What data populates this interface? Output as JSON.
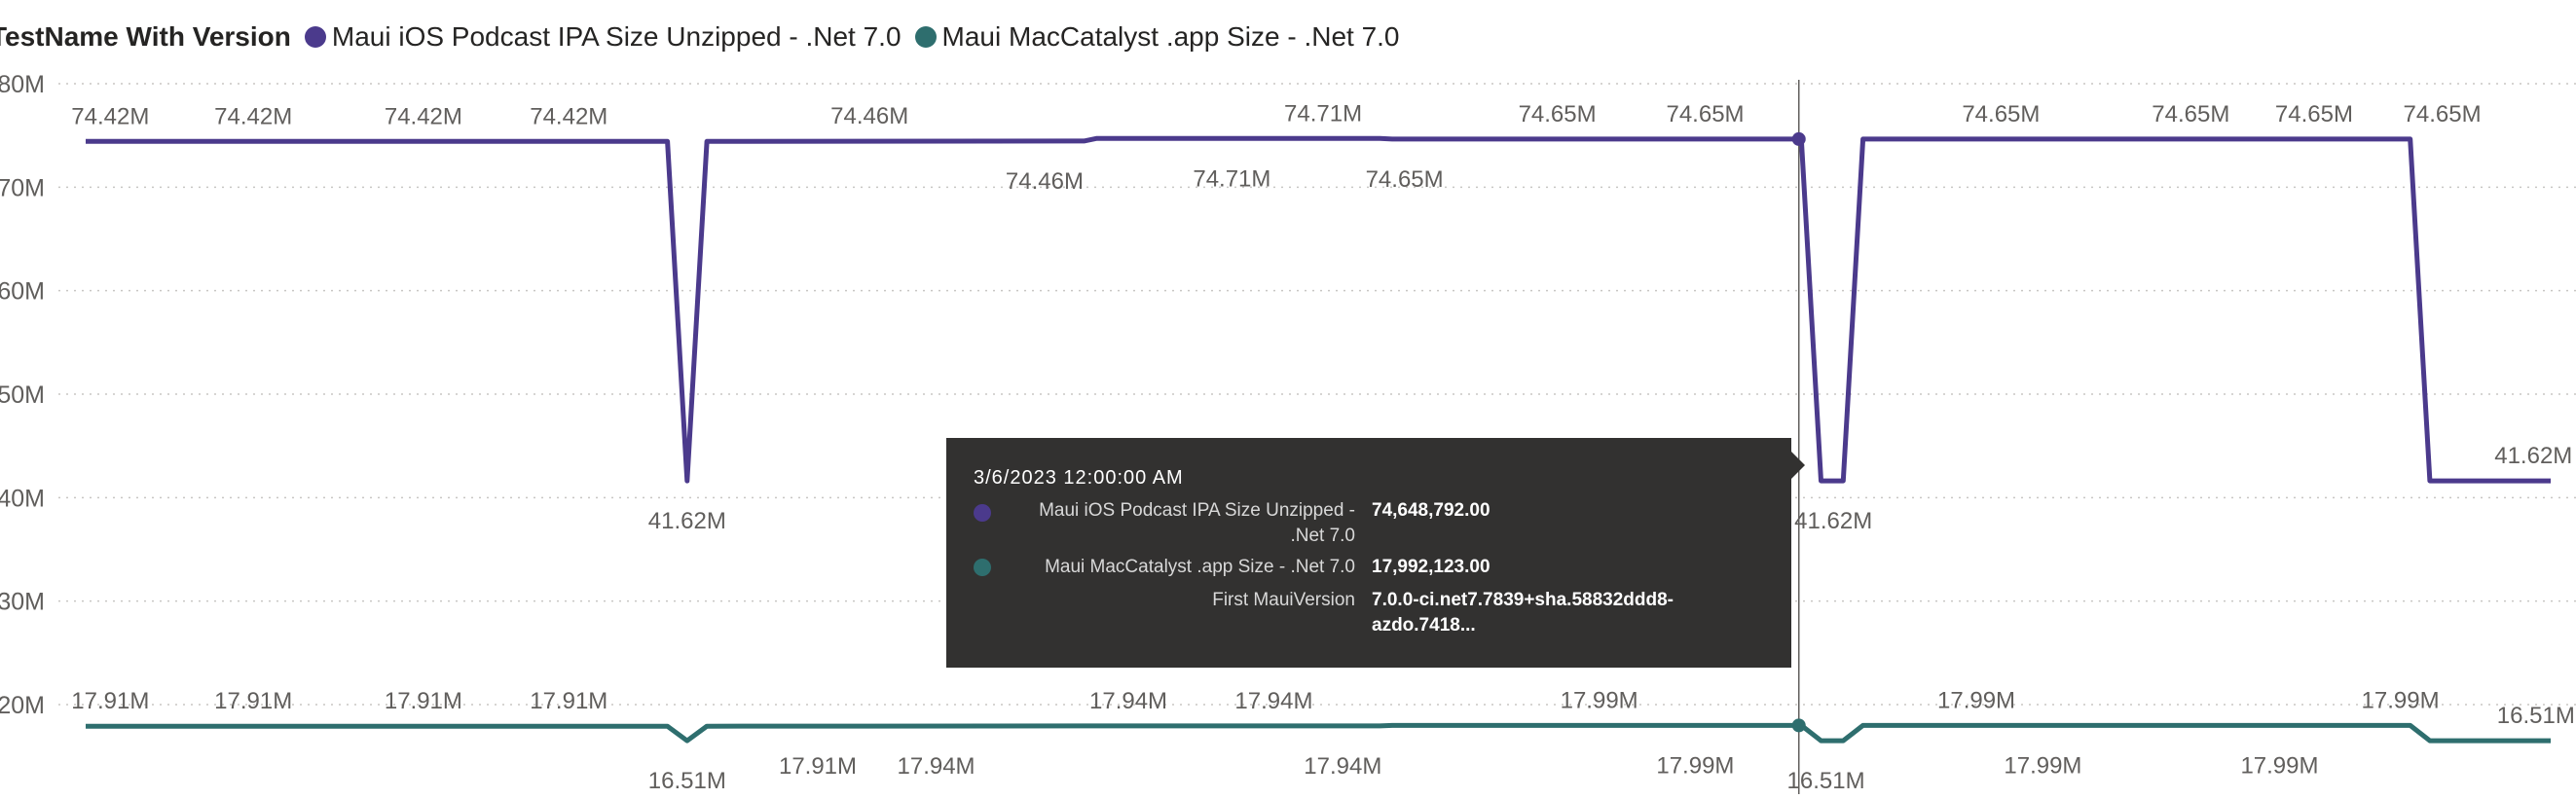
{
  "legend": {
    "title": "TestName With Version",
    "items": [
      {
        "label": "Maui iOS Podcast IPA Size Unzipped - .Net 7.0",
        "color": "#4B3A8C"
      },
      {
        "label": "Maui MacCatalyst .app Size - .Net 7.0",
        "color": "#2E6E6E"
      }
    ]
  },
  "tooltip": {
    "date": "3/6/2023 12:00:00 AM",
    "rows": [
      {
        "label": "Maui iOS Podcast IPA Size Unzipped - .Net 7.0",
        "value": "74,648,792.00",
        "color": "#4B3A8C"
      },
      {
        "label": "Maui MacCatalyst .app Size - .Net 7.0",
        "value": "17,992,123.00",
        "color": "#2E6E6E"
      },
      {
        "label": "First MauiVersion",
        "value": "7.0.0-ci.net7.7839+sha.58832ddd8-azdo.7418..."
      }
    ]
  },
  "chart_data": {
    "type": "line",
    "grid": true,
    "legend_position": "top-left",
    "ylim": [
      20,
      80
    ],
    "y_ticks": [
      "30M",
      "40M",
      "50M",
      "60M",
      "70M",
      "80M"
    ],
    "xlabel": "",
    "ylabel": "",
    "crosshair_date": "3/6/2023 12:00:00 AM",
    "series": [
      {
        "name": "Maui iOS Podcast IPA Size Unzipped - .Net 7.0",
        "color": "#4B3A8C",
        "points": [
          {
            "x": 0,
            "y": 74.42
          },
          {
            "x": 0.236,
            "y": 74.42
          },
          {
            "x": 0.244,
            "y": 41.62
          },
          {
            "x": 0.252,
            "y": 74.42
          },
          {
            "x": 0.405,
            "y": 74.46
          },
          {
            "x": 0.41,
            "y": 74.71
          },
          {
            "x": 0.525,
            "y": 74.71
          },
          {
            "x": 0.53,
            "y": 74.65
          },
          {
            "x": 0.696,
            "y": 74.65
          },
          {
            "x": 0.704,
            "y": 41.62
          },
          {
            "x": 0.713,
            "y": 41.62
          },
          {
            "x": 0.721,
            "y": 74.65
          },
          {
            "x": 0.943,
            "y": 74.65
          },
          {
            "x": 0.951,
            "y": 41.62
          },
          {
            "x": 1,
            "y": 41.62
          }
        ],
        "data_labels": [
          {
            "text": "74.42M",
            "x": 0.01,
            "pos": "above",
            "y": 74.42
          },
          {
            "text": "74.42M",
            "x": 0.068,
            "pos": "above",
            "y": 74.42
          },
          {
            "text": "74.42M",
            "x": 0.137,
            "pos": "above",
            "y": 74.42
          },
          {
            "text": "74.42M",
            "x": 0.196,
            "pos": "above",
            "y": 74.42
          },
          {
            "text": "41.62M",
            "x": 0.244,
            "pos": "below",
            "y": 41.62
          },
          {
            "text": "74.46M",
            "x": 0.318,
            "pos": "above",
            "y": 74.46
          },
          {
            "text": "74.46M",
            "x": 0.389,
            "pos": "below",
            "y": 74.46
          },
          {
            "text": "74.71M",
            "x": 0.465,
            "pos": "below",
            "y": 74.71
          },
          {
            "text": "74.71M",
            "x": 0.502,
            "pos": "above",
            "y": 74.71
          },
          {
            "text": "74.65M",
            "x": 0.535,
            "pos": "below",
            "y": 74.65
          },
          {
            "text": "74.65M",
            "x": 0.597,
            "pos": "above",
            "y": 74.65
          },
          {
            "text": "74.65M",
            "x": 0.657,
            "pos": "above",
            "y": 74.65
          },
          {
            "text": "41.62M",
            "x": 0.709,
            "pos": "below",
            "y": 41.62
          },
          {
            "text": "74.65M",
            "x": 0.777,
            "pos": "above",
            "y": 74.65
          },
          {
            "text": "74.65M",
            "x": 0.854,
            "pos": "above",
            "y": 74.65
          },
          {
            "text": "74.65M",
            "x": 0.904,
            "pos": "above",
            "y": 74.65
          },
          {
            "text": "74.65M",
            "x": 0.956,
            "pos": "above",
            "y": 74.65
          },
          {
            "text": "41.62M",
            "x": 0.993,
            "pos": "above",
            "y": 41.62
          }
        ]
      },
      {
        "name": "Maui MacCatalyst .app Size - .Net 7.0",
        "color": "#2E6E6E",
        "points": [
          {
            "x": 0,
            "y": 17.91
          },
          {
            "x": 0.236,
            "y": 17.91
          },
          {
            "x": 0.244,
            "y": 16.51
          },
          {
            "x": 0.252,
            "y": 17.91
          },
          {
            "x": 0.405,
            "y": 17.94
          },
          {
            "x": 0.525,
            "y": 17.94
          },
          {
            "x": 0.53,
            "y": 17.99
          },
          {
            "x": 0.696,
            "y": 17.99
          },
          {
            "x": 0.704,
            "y": 16.51
          },
          {
            "x": 0.713,
            "y": 16.51
          },
          {
            "x": 0.721,
            "y": 17.99
          },
          {
            "x": 0.943,
            "y": 17.99
          },
          {
            "x": 0.951,
            "y": 16.51
          },
          {
            "x": 1,
            "y": 16.51
          }
        ],
        "data_labels": [
          {
            "text": "17.91M",
            "x": 0.01,
            "pos": "above",
            "y": 17.91
          },
          {
            "text": "17.91M",
            "x": 0.068,
            "pos": "above",
            "y": 17.91
          },
          {
            "text": "17.91M",
            "x": 0.137,
            "pos": "above",
            "y": 17.91
          },
          {
            "text": "17.91M",
            "x": 0.196,
            "pos": "above",
            "y": 17.91
          },
          {
            "text": "16.51M",
            "x": 0.244,
            "pos": "below",
            "y": 16.51
          },
          {
            "text": "17.91M",
            "x": 0.297,
            "pos": "below",
            "y": 17.91
          },
          {
            "text": "17.94M",
            "x": 0.345,
            "pos": "below",
            "y": 17.94
          },
          {
            "text": "17.94M",
            "x": 0.423,
            "pos": "above",
            "y": 17.94
          },
          {
            "text": "17.94M",
            "x": 0.482,
            "pos": "above",
            "y": 17.94
          },
          {
            "text": "17.94M",
            "x": 0.51,
            "pos": "below",
            "y": 17.94
          },
          {
            "text": "17.99M",
            "x": 0.614,
            "pos": "above",
            "y": 17.99
          },
          {
            "text": "17.99M",
            "x": 0.653,
            "pos": "below",
            "y": 17.99
          },
          {
            "text": "16.51M",
            "x": 0.706,
            "pos": "below",
            "y": 16.51
          },
          {
            "text": "17.99M",
            "x": 0.767,
            "pos": "above",
            "y": 17.99
          },
          {
            "text": "17.99M",
            "x": 0.794,
            "pos": "below",
            "y": 17.99
          },
          {
            "text": "17.99M",
            "x": 0.89,
            "pos": "below",
            "y": 17.99
          },
          {
            "text": "17.99M",
            "x": 0.939,
            "pos": "above",
            "y": 17.99
          },
          {
            "text": "16.51M",
            "x": 0.994,
            "pos": "above",
            "y": 16.51
          }
        ]
      }
    ]
  }
}
